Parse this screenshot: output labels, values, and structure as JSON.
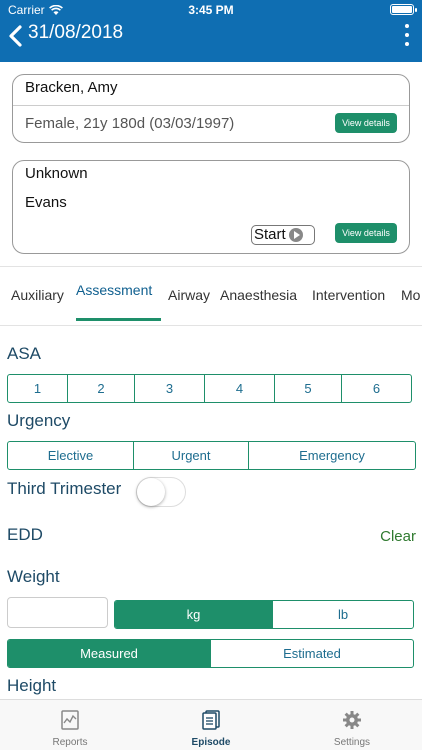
{
  "status_bar": {
    "carrier": "Carrier",
    "time": "3:45 PM"
  },
  "nav": {
    "title": "31/08/2018"
  },
  "patient_card": {
    "name": "Bracken, Amy",
    "details": "Female, 21y 180d (03/03/1997)",
    "view_details_label": "View details"
  },
  "staff_card": {
    "line1": "Unknown",
    "line2": "Evans",
    "start_label": "Start",
    "view_details_label": "View details"
  },
  "tabs": [
    "Auxiliary",
    "Assessment",
    "Airway",
    "Anaesthesia",
    "Intervention",
    "Mo"
  ],
  "active_tab": "Assessment",
  "asa": {
    "label": "ASA",
    "options": [
      "1",
      "2",
      "3",
      "4",
      "5",
      "6"
    ]
  },
  "urgency": {
    "label": "Urgency",
    "options": [
      "Elective",
      "Urgent",
      "Emergency"
    ]
  },
  "third_trimester": {
    "label": "Third Trimester",
    "on": false
  },
  "edd": {
    "label": "EDD",
    "clear_label": "Clear"
  },
  "weight": {
    "label": "Weight",
    "value": "",
    "units": [
      "kg",
      "lb"
    ],
    "selected_unit": "kg",
    "methods": [
      "Measured",
      "Estimated"
    ],
    "selected_method": "Measured"
  },
  "height": {
    "label": "Height"
  },
  "bottom_tabs": [
    {
      "label": "Reports",
      "icon": "reports-icon"
    },
    {
      "label": "Episode",
      "icon": "episode-icon"
    },
    {
      "label": "Settings",
      "icon": "settings-icon"
    }
  ],
  "active_bottom_tab": "Episode",
  "colors": {
    "header": "#0f6eb2",
    "accent": "#1e8f6a",
    "label": "#1e4a66"
  }
}
